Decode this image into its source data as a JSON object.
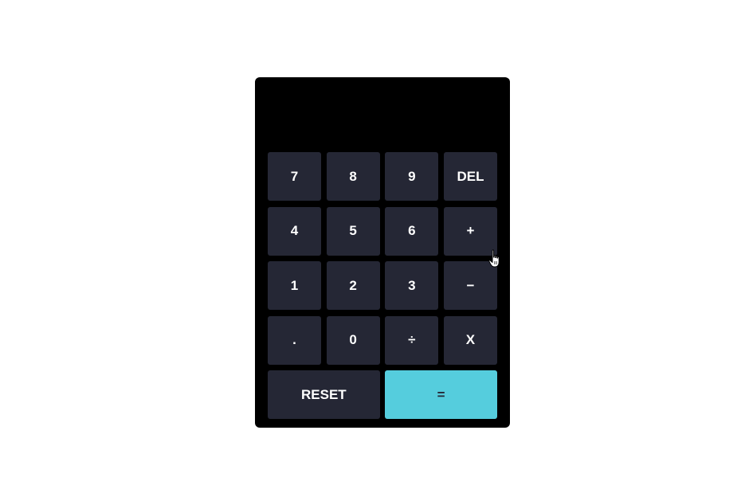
{
  "display": {
    "value": ""
  },
  "keypad": {
    "keys": [
      {
        "label": "7",
        "name": "key-7"
      },
      {
        "label": "8",
        "name": "key-8"
      },
      {
        "label": "9",
        "name": "key-9"
      },
      {
        "label": "DEL",
        "name": "delete-button"
      },
      {
        "label": "4",
        "name": "key-4"
      },
      {
        "label": "5",
        "name": "key-5"
      },
      {
        "label": "6",
        "name": "key-6"
      },
      {
        "label": "+",
        "name": "add-button"
      },
      {
        "label": "1",
        "name": "key-1"
      },
      {
        "label": "2",
        "name": "key-2"
      },
      {
        "label": "3",
        "name": "key-3"
      },
      {
        "label": "−",
        "name": "subtract-button"
      },
      {
        "label": ".",
        "name": "decimal-button"
      },
      {
        "label": "0",
        "name": "key-0"
      },
      {
        "label": "÷",
        "name": "divide-button"
      },
      {
        "label": "X",
        "name": "multiply-button"
      }
    ],
    "reset_label": "RESET",
    "equals_label": "="
  },
  "colors": {
    "panel": "#000000",
    "key": "#252735",
    "key_text": "#ffffff",
    "accent": "#55cddd"
  },
  "cursor": {
    "icon": "hand-pointer-icon"
  }
}
